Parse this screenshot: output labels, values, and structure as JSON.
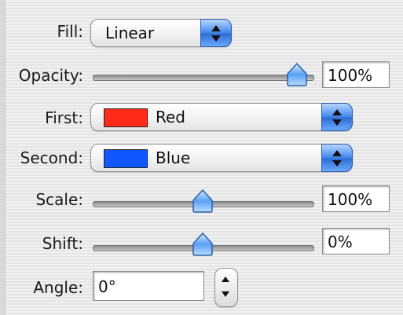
{
  "fill": {
    "label": "Fill:",
    "value": "Linear"
  },
  "opacity": {
    "label": "Opacity:",
    "value": "100%",
    "slider_fraction": 1.0
  },
  "first": {
    "label": "First:",
    "color_name": "Red",
    "color": "#ff2a1a"
  },
  "second": {
    "label": "Second:",
    "color_name": "Blue",
    "color": "#1256ff"
  },
  "scale": {
    "label": "Scale:",
    "value": "100%",
    "slider_fraction": 0.5
  },
  "shift": {
    "label": "Shift:",
    "value": "0%",
    "slider_fraction": 0.5
  },
  "angle": {
    "label": "Angle:",
    "value": "0°"
  },
  "icons": {
    "popup": "up-down-arrows-icon",
    "thumb": "slider-thumb-icon",
    "stepper": "stepper-arrows-icon"
  }
}
